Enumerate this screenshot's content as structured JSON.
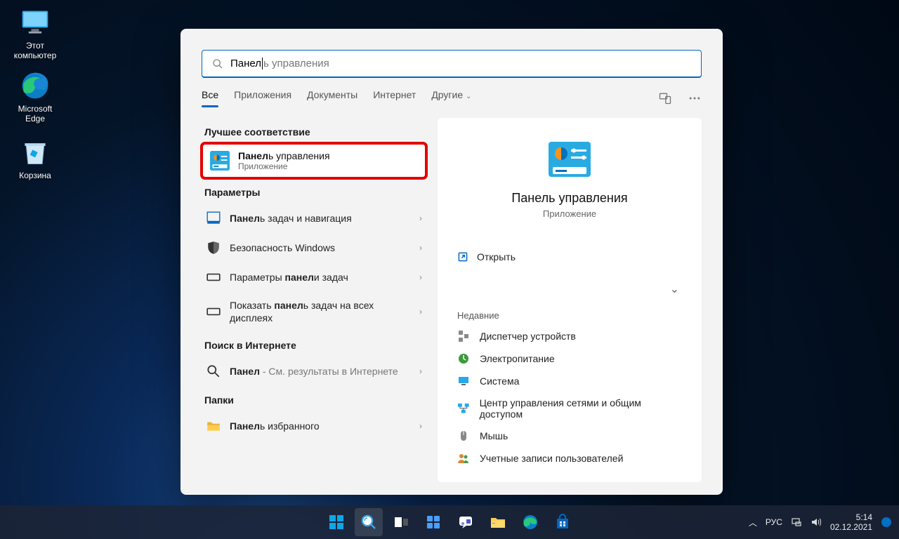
{
  "desktop": {
    "this_pc": "Этот\nкомпьютер",
    "edge": "Microsoft\nEdge",
    "recycle": "Корзина"
  },
  "search": {
    "query_typed": "Панел",
    "query_hint": "ь управления",
    "tabs": [
      "Все",
      "Приложения",
      "Документы",
      "Интернет",
      "Другие"
    ],
    "best_match_label": "Лучшее соответствие",
    "best_match": {
      "title_bold": "Панел",
      "title_rest": "ь управления",
      "subtitle": "Приложение"
    },
    "settings_label": "Параметры",
    "settings": [
      {
        "bold": "Панел",
        "rest": "ь задач и навигация"
      },
      {
        "bold": "",
        "rest": "Безопасность Windows"
      },
      {
        "bold2": "панел",
        "pre": "Параметры ",
        "rest": "и задач"
      },
      {
        "bold2": "панел",
        "pre": "Показать ",
        "rest": "ь задач на всех дисплеях"
      }
    ],
    "web_label": "Поиск в Интернете",
    "web": {
      "bold": "Панел",
      "rest": " - См. результаты в Интернете"
    },
    "folders_label": "Папки",
    "folder": {
      "bold": "Панел",
      "rest": "ь избранного"
    }
  },
  "preview": {
    "title": "Панель управления",
    "subtitle": "Приложение",
    "open": "Открыть",
    "recent_label": "Недавние",
    "recent": [
      "Диспетчер устройств",
      "Электропитание",
      "Система",
      "Центр управления сетями и общим доступом",
      "Мышь",
      "Учетные записи пользователей"
    ]
  },
  "taskbar": {
    "lang": "РУС",
    "time": "5:14",
    "date": "02.12.2021"
  }
}
